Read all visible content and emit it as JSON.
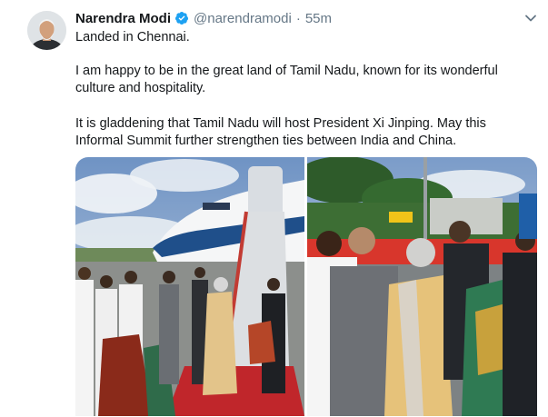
{
  "tweet": {
    "author_name": "Narendra Modi",
    "handle": "@narendramodi",
    "separator": "·",
    "time": "55m",
    "lines": [
      "Landed in Chennai.",
      "I am happy to be in the great land of Tamil Nadu, known for its wonderful culture and hospitality.",
      "It is gladdening that Tamil Nadu will host President Xi Jinping. May this Informal Summit further strengthen ties between India and China."
    ]
  },
  "icons": {
    "verified": "verified-badge-icon",
    "menu": "chevron-down-icon"
  },
  "colors": {
    "verified_blue": "#1da1f2",
    "secondary_text": "#657786",
    "primary_text": "#14171a"
  },
  "media": {
    "count": 2
  }
}
